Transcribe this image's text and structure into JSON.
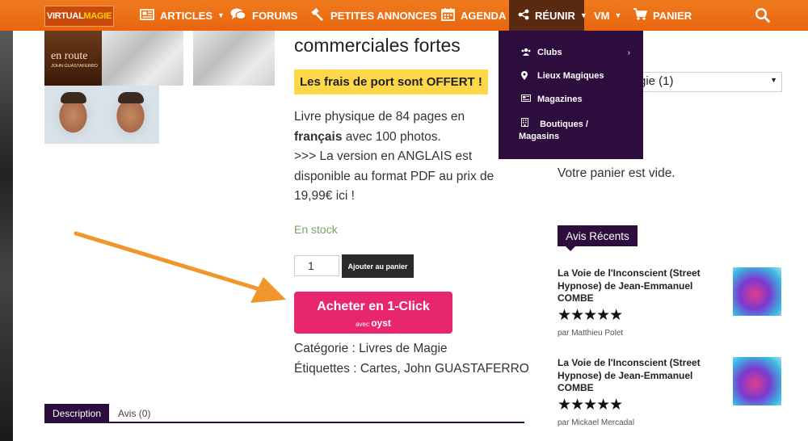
{
  "nav": {
    "logo_part1": "VIRTUAL",
    "logo_part2": "MAGIE",
    "items": [
      {
        "label": "ARTICLES",
        "icon": "newspaper-icon"
      },
      {
        "label": "FORUMS",
        "icon": "chat-bubbles-icon"
      },
      {
        "label": "PETITES ANNONCES",
        "icon": "hammer-icon"
      },
      {
        "label": "AGENDA",
        "icon": "calendar-icon"
      },
      {
        "label": "RÉUNIR",
        "icon": "share-icon"
      },
      {
        "label": "VM",
        "icon": ""
      },
      {
        "label": "PANIER",
        "icon": "cart-icon"
      }
    ],
    "search_icon": "search-icon"
  },
  "dropdown": {
    "items": [
      {
        "label": "Clubs",
        "icon": "users-icon"
      },
      {
        "label": "Lieux Magiques",
        "icon": "map-pin-icon"
      },
      {
        "label": "Magazines",
        "icon": "newspaper-icon"
      },
      {
        "label": "Boutiques /",
        "label2": "Magasins",
        "icon": "building-icon"
      }
    ]
  },
  "gallery": {
    "book_title": "en route",
    "book_author": "JOHN GUASTAFERRO"
  },
  "product": {
    "title": "commerciales fortes",
    "shipping": "Les frais de port sont OFFERT !",
    "desc_line1_pre": "Livre physique de 84 pages en",
    "desc_bold": "français",
    "desc_line2_post": " avec 100 photos.",
    "desc_line3": ">>> La version en ANGLAIS est disponible au format PDF au prix de 19,99€ ici !",
    "stock": "En stock",
    "quantity": "1",
    "add_to_cart": "Ajouter au panier",
    "buy_main": "Acheter en 1-Click",
    "buy_sub_prefix": "avec",
    "buy_sub_brand": "oyst",
    "category": "Catégorie : Livres de Magie",
    "tags": "Étiquettes : Cartes, John GUASTAFERRO"
  },
  "tabs": {
    "description": "Description",
    "reviews": "Avis (0)"
  },
  "sidebar": {
    "select_value": "gie  (1)",
    "cart_empty": "Votre panier est vide.",
    "recent_heading": "Avis Récents",
    "reviews": [
      {
        "title": "La Voie de l'Inconscient (Street Hypnose) de Jean-Emmanuel COMBE",
        "stars": "★★★★★",
        "rating": 5,
        "author": "par Matthieu Polet"
      },
      {
        "title": "La Voie de l'Inconscient (Street Hypnose) de Jean-Emmanuel COMBE",
        "stars": "★★★★★",
        "rating": 5,
        "author": "par Mickael Mercadal"
      }
    ]
  },
  "colors": {
    "nav_orange": "#e8650e",
    "purple": "#2d0d3e",
    "buy_pink": "#e8266e",
    "shipping_yellow": "#ffd84a",
    "stock_green": "#77a464",
    "arrow_orange": "#f0962a"
  }
}
